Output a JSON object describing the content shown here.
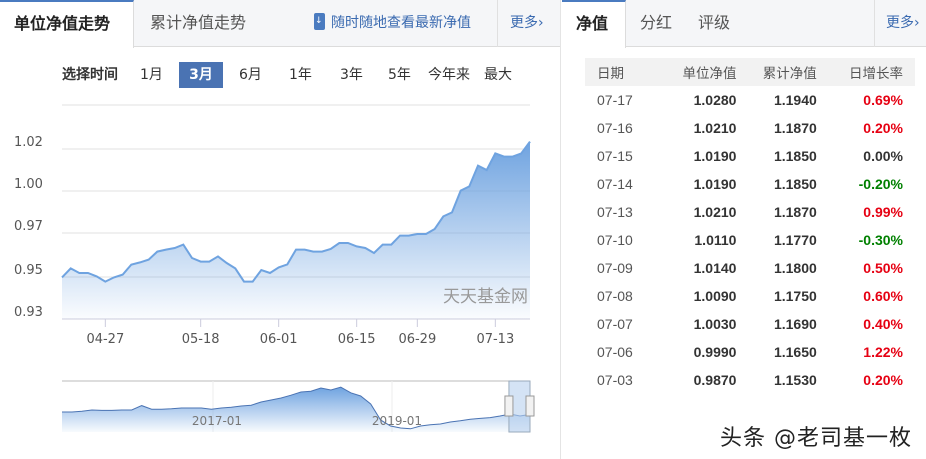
{
  "left": {
    "tabs": [
      {
        "label": "单位净值走势",
        "active": true
      },
      {
        "label": "累计净值走势",
        "active": false
      }
    ],
    "promo": "随时随地查看最新净值",
    "more": "更多›",
    "range": {
      "label": "选择时间",
      "options": [
        "1月",
        "3月",
        "6月",
        "1年",
        "3年",
        "5年",
        "今年来",
        "最大"
      ],
      "selected": "3月"
    },
    "watermark": "天天基金网"
  },
  "chart_data": {
    "type": "area",
    "title": "单位净值走势",
    "xlabel": "",
    "ylabel": "",
    "ylim": [
      0.925,
      1.032
    ],
    "yticks": [
      {
        "value": 0.925,
        "label": "0.93"
      },
      {
        "value": 0.946,
        "label": "0.95"
      },
      {
        "value": 0.968,
        "label": "0.97"
      },
      {
        "value": 0.989,
        "label": "1.00"
      },
      {
        "value": 1.01,
        "label": "1.02"
      }
    ],
    "xticks": [
      {
        "index": 5,
        "label": "04-27"
      },
      {
        "index": 16,
        "label": "05-18"
      },
      {
        "index": 25,
        "label": "06-01"
      },
      {
        "index": 34,
        "label": "06-15"
      },
      {
        "index": 41,
        "label": "06-29"
      },
      {
        "index": 50,
        "label": "07-13"
      }
    ],
    "values": [
      0.9458,
      0.9503,
      0.948,
      0.948,
      0.9463,
      0.9437,
      0.9458,
      0.9472,
      0.9522,
      0.9533,
      0.9547,
      0.9587,
      0.9597,
      0.9605,
      0.9622,
      0.9555,
      0.9537,
      0.9537,
      0.9563,
      0.953,
      0.9503,
      0.9437,
      0.9437,
      0.9495,
      0.948,
      0.9508,
      0.9523,
      0.9597,
      0.9597,
      0.9587,
      0.9587,
      0.96,
      0.963,
      0.963,
      0.9613,
      0.9605,
      0.958,
      0.9622,
      0.9622,
      0.9667,
      0.9667,
      0.9675,
      0.9675,
      0.97,
      0.9763,
      0.9783,
      0.9892,
      0.9913,
      1.0017,
      0.9995,
      1.0078,
      1.0062,
      1.0062,
      1.0078,
      1.0137
    ],
    "navigator": {
      "labels": [
        "2017-01",
        "2019-01"
      ],
      "values": [
        0.2,
        0.2,
        0.22,
        0.25,
        0.24,
        0.24,
        0.25,
        0.25,
        0.36,
        0.27,
        0.27,
        0.28,
        0.3,
        0.3,
        0.3,
        0.27,
        0.3,
        0.32,
        0.35,
        0.37,
        0.45,
        0.5,
        0.55,
        0.62,
        0.7,
        0.72,
        0.8,
        0.75,
        0.82,
        0.68,
        0.6,
        0.4,
        0.0,
        -0.15,
        -0.2,
        -0.22,
        -0.15,
        -0.12,
        -0.1,
        -0.05,
        -0.02,
        0.02,
        0.04,
        0.06,
        0.1,
        0.15,
        0.1,
        0.14
      ],
      "selection": [
        0.955,
        1.0
      ]
    }
  },
  "right": {
    "tabs": [
      {
        "label": "净值",
        "active": true
      },
      {
        "label": "分红",
        "active": false
      },
      {
        "label": "评级",
        "active": false
      }
    ],
    "more": "更多›",
    "columns": [
      "日期",
      "单位净值",
      "累计净值",
      "日增长率"
    ],
    "rows": [
      {
        "date": "07-17",
        "nav": "1.0280",
        "acc": "1.1940",
        "chg": "0.69%",
        "dir": "up"
      },
      {
        "date": "07-16",
        "nav": "1.0210",
        "acc": "1.1870",
        "chg": "0.20%",
        "dir": "up"
      },
      {
        "date": "07-15",
        "nav": "1.0190",
        "acc": "1.1850",
        "chg": "0.00%",
        "dir": "flat"
      },
      {
        "date": "07-14",
        "nav": "1.0190",
        "acc": "1.1850",
        "chg": "-0.20%",
        "dir": "down"
      },
      {
        "date": "07-13",
        "nav": "1.0210",
        "acc": "1.1870",
        "chg": "0.99%",
        "dir": "up"
      },
      {
        "date": "07-10",
        "nav": "1.0110",
        "acc": "1.1770",
        "chg": "-0.30%",
        "dir": "down"
      },
      {
        "date": "07-09",
        "nav": "1.0140",
        "acc": "1.1800",
        "chg": "0.50%",
        "dir": "up"
      },
      {
        "date": "07-08",
        "nav": "1.0090",
        "acc": "1.1750",
        "chg": "0.60%",
        "dir": "up"
      },
      {
        "date": "07-07",
        "nav": "1.0030",
        "acc": "1.1690",
        "chg": "0.40%",
        "dir": "up"
      },
      {
        "date": "07-06",
        "nav": "0.9990",
        "acc": "1.1650",
        "chg": "1.22%",
        "dir": "up"
      },
      {
        "date": "07-03",
        "nav": "0.9870",
        "acc": "1.1530",
        "chg": "0.20%",
        "dir": "up"
      }
    ]
  },
  "colors": {
    "up": "#e60012",
    "down": "#008000",
    "flat": "#333333",
    "accent": "#4a73b3",
    "line": "#6fa3e0"
  },
  "overlay_watermark": "头条 @老司基一枚"
}
